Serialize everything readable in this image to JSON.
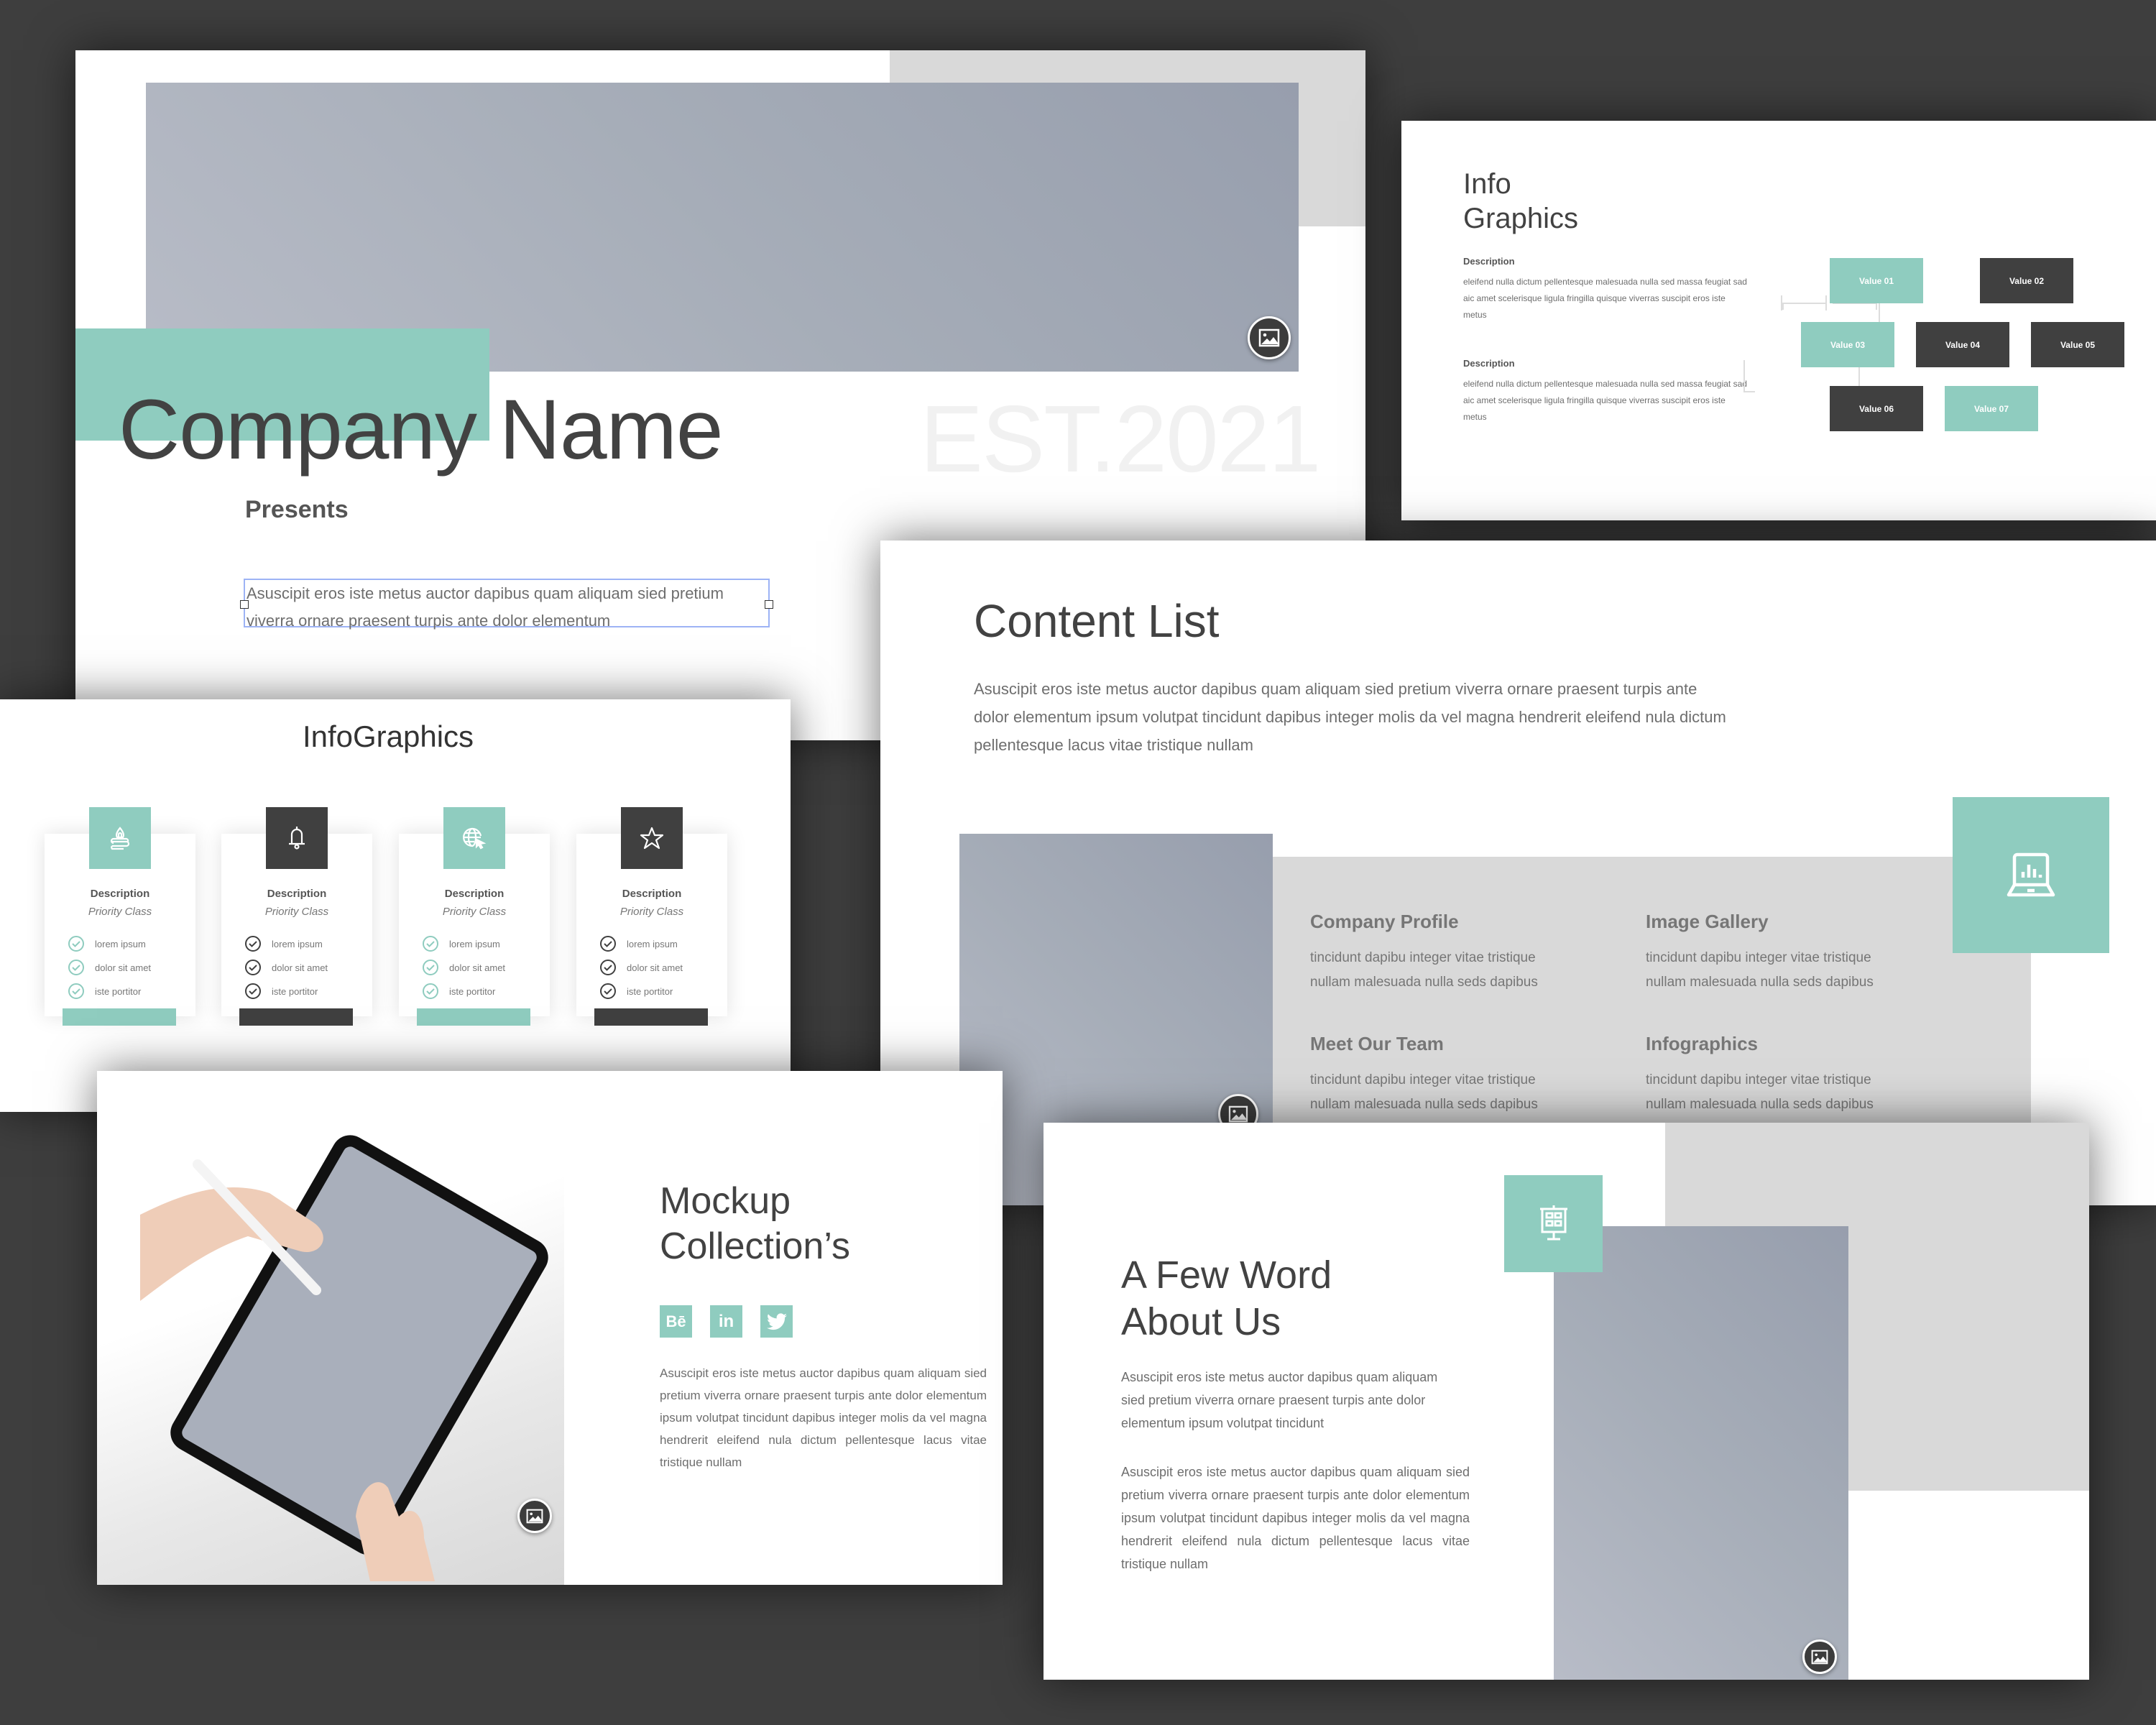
{
  "colors": {
    "accent": "#8fccbf",
    "dark": "#404040",
    "background": "#3e3e3e",
    "placeholder": "#a6adb8",
    "panel_gray": "#d9d9d9"
  },
  "slide_cover": {
    "title": "Company Name",
    "watermark": "EST.2021",
    "subtitle": "Presents",
    "body": "Asuscipit eros iste metus auctor dapibus quam aliquam sied pretium viverra ornare praesent turpis ante dolor elementum",
    "image_icon": "image-icon"
  },
  "slide_info_graphics": {
    "title_line1": "Info",
    "title_line2": "Graphics",
    "descriptions": [
      {
        "heading": "Description",
        "text": "eleifend nulla dictum pellentesque malesuada nulla sed massa feugiat sad aic amet scelerisque ligula fringilla quisque viverras suscipit eros iste metus"
      },
      {
        "heading": "Description",
        "text": "eleifend nulla dictum pellentesque malesuada nulla sed massa feugiat sad aic amet scelerisque ligula fringilla quisque viverras suscipit eros iste metus"
      }
    ],
    "boxes": [
      {
        "label": "Value 01",
        "color": "teal"
      },
      {
        "label": "Value 02",
        "color": "dark"
      },
      {
        "label": "Value 03",
        "color": "teal"
      },
      {
        "label": "Value 04",
        "color": "dark"
      },
      {
        "label": "Value 05",
        "color": "dark"
      },
      {
        "label": "Value 06",
        "color": "dark"
      },
      {
        "label": "Value 07",
        "color": "teal"
      }
    ]
  },
  "slide_infographics_cards": {
    "title": "InfoGraphics",
    "cards": [
      {
        "icon": "candle-icon",
        "color": "teal",
        "title": "Description",
        "subtitle": "Priority Class",
        "items": [
          "lorem ipsum",
          "dolor sit amet",
          "iste portitor"
        ]
      },
      {
        "icon": "bell-icon",
        "color": "dark",
        "title": "Description",
        "subtitle": "Priority Class",
        "items": [
          "lorem ipsum",
          "dolor sit amet",
          "iste portitor"
        ]
      },
      {
        "icon": "globe-cursor-icon",
        "color": "teal",
        "title": "Description",
        "subtitle": "Priority Class",
        "items": [
          "lorem ipsum",
          "dolor sit amet",
          "iste portitor"
        ]
      },
      {
        "icon": "star-icon",
        "color": "dark",
        "title": "Description",
        "subtitle": "Priority Class",
        "items": [
          "lorem ipsum",
          "dolor sit amet",
          "iste portitor"
        ]
      }
    ]
  },
  "slide_content_list": {
    "title": "Content List",
    "body": "Asuscipit eros iste metus auctor dapibus quam aliquam sied pretium viverra ornare praesent turpis ante dolor elementum ipsum volutpat tincidunt dapibus integer molis da vel magna hendrerit eleifend nula dictum pellentesque lacus vitae tristique nullam",
    "icon": "laptop-chart-icon",
    "items": [
      {
        "heading": "Company Profile",
        "line1": "tincidunt dapibu integer vitae tristique",
        "line2": "nullam malesuada nulla seds dapibus"
      },
      {
        "heading": "Image Gallery",
        "line1": "tincidunt dapibu integer vitae tristique",
        "line2": "nullam malesuada nulla seds dapibus"
      },
      {
        "heading": "Meet Our Team",
        "line1": "tincidunt dapibu integer vitae tristique",
        "line2": "nullam malesuada nulla seds dapibus"
      },
      {
        "heading": "Infographics",
        "line1": "tincidunt dapibu integer vitae tristique",
        "line2": "nullam malesuada nulla seds dapibus"
      }
    ]
  },
  "slide_mockup": {
    "title_line1": "Mockup",
    "title_line2": "Collection’s",
    "social": [
      {
        "name": "behance",
        "label": "Bē"
      },
      {
        "name": "linkedin",
        "label": "in"
      },
      {
        "name": "twitter",
        "label": ""
      }
    ],
    "body": "Asuscipit eros iste metus auctor dapibus quam aliquam sied pretium viverra ornare praesent turpis ante dolor elementum ipsum volutpat tincidunt dapibus integer molis da vel magna hendrerit eleifend nula dictum pellentesque lacus vitae tristique nullam"
  },
  "slide_about": {
    "title_line1": "A Few Word",
    "title_line2": "About Us",
    "body1": "Asuscipit eros iste metus auctor dapibus quam aliquam sied pretium viverra ornare praesent turpis ante dolor elementum ipsum volutpat tincidunt",
    "body2": "Asuscipit eros iste metus auctor dapibus quam aliquam sied pretium viverra ornare praesent turpis ante dolor elementum ipsum volutpat tincidunt dapibus integer molis da vel magna hendrerit eleifend nula dictum pellentesque lacus vitae tristique nullam",
    "icon": "presentation-board-icon"
  }
}
